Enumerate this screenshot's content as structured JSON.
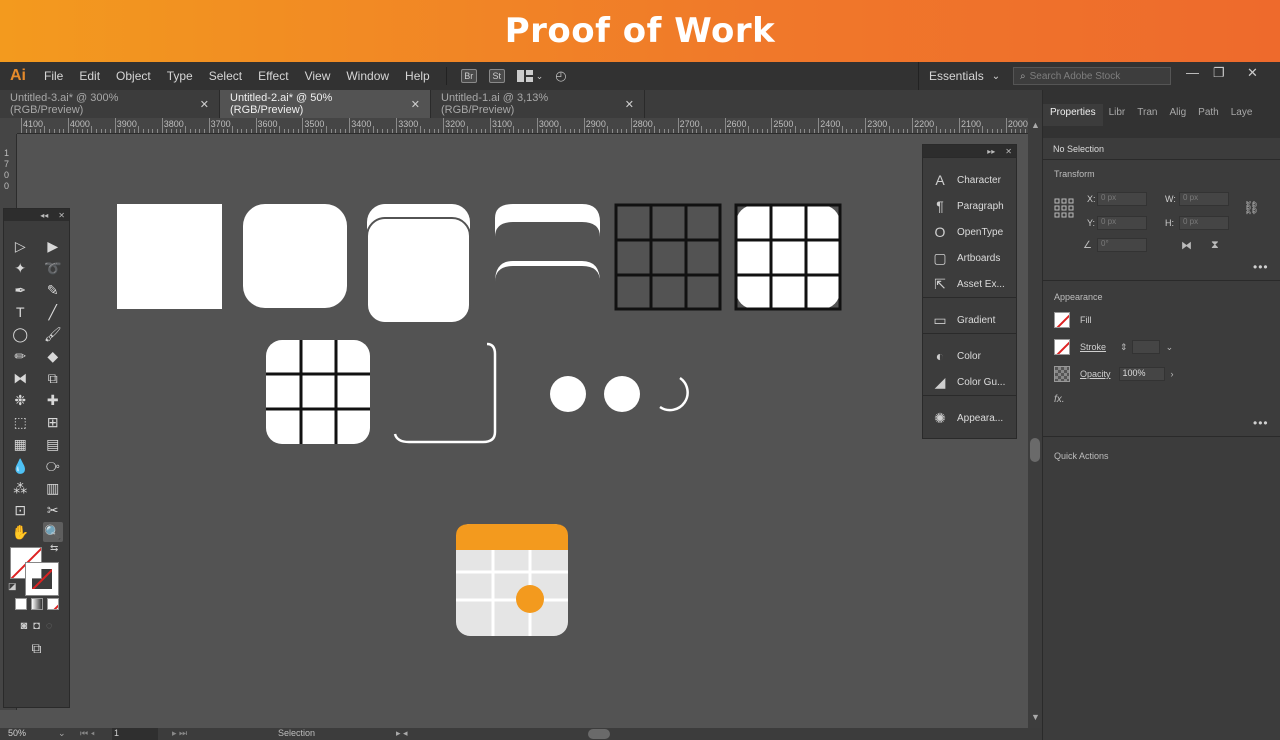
{
  "banner": {
    "title": "Proof of Work"
  },
  "app": {
    "logo": "Ai",
    "brand_color": "#e58a2b",
    "accent_orange": "#f39a1e"
  },
  "menu": {
    "items": [
      "File",
      "Edit",
      "Object",
      "Type",
      "Select",
      "Effect",
      "View",
      "Window",
      "Help"
    ],
    "bridge": "Br",
    "stock": "St",
    "workspace": "Essentials",
    "search_placeholder": "Search Adobe Stock",
    "minimize": "—",
    "restore": "❐",
    "close": "✕"
  },
  "tabs": [
    {
      "label": "Untitled-3.ai* @ 300% (RGB/Preview)",
      "close": "✕"
    },
    {
      "label": "Untitled-2.ai* @ 50% (RGB/Preview)",
      "close": "✕"
    },
    {
      "label": "Untitled-1.ai @ 3,13% (RGB/Preview)",
      "close": "✕"
    }
  ],
  "ruler": {
    "h_labels": [
      "4100",
      "4000",
      "3900",
      "3800",
      "3700",
      "3600",
      "3500",
      "3400",
      "3300",
      "3200",
      "3100",
      "3000",
      "2900",
      "2800",
      "2700",
      "2600",
      "2500",
      "2400",
      "2300",
      "2200",
      "2100",
      "2000"
    ],
    "v_label": "1700"
  },
  "float_panel": {
    "collapse": "▸▸",
    "close": "✕",
    "items": [
      {
        "label": "Character",
        "icon": "A"
      },
      {
        "label": "Paragraph",
        "icon": "¶"
      },
      {
        "label": "OpenType",
        "icon": "O"
      },
      {
        "label": "Artboards",
        "icon": "▢"
      },
      {
        "label": "Asset Ex...",
        "icon": "⇱"
      },
      {
        "label": "Gradient",
        "icon": "▭"
      },
      {
        "label": "Color",
        "icon": "◐"
      },
      {
        "label": "Color Gu...",
        "icon": "◢"
      },
      {
        "label": "Appeara...",
        "icon": "✺"
      }
    ]
  },
  "tools_panel": {
    "collapse": "◂◂",
    "close": "✕"
  },
  "properties": {
    "tabs": [
      "Properties",
      "Libr",
      "Tran",
      "Alig",
      "Path",
      "Laye"
    ],
    "no_selection": "No Selection",
    "transform": {
      "title": "Transform",
      "x_label": "X:",
      "x_value": "0 px",
      "y_label": "Y:",
      "y_value": "0 px",
      "w_label": "W:",
      "w_value": "0 px",
      "h_label": "H:",
      "h_value": "0 px",
      "angle_value": "0°"
    },
    "appearance": {
      "title": "Appearance",
      "fill": "Fill",
      "stroke": "Stroke",
      "opacity": "Opacity",
      "opacity_value": "100%",
      "fx": "fx."
    },
    "more": "•••",
    "quick_actions": "Quick Actions"
  },
  "status": {
    "zoom": "50%",
    "page": "1",
    "mode": "Selection"
  }
}
